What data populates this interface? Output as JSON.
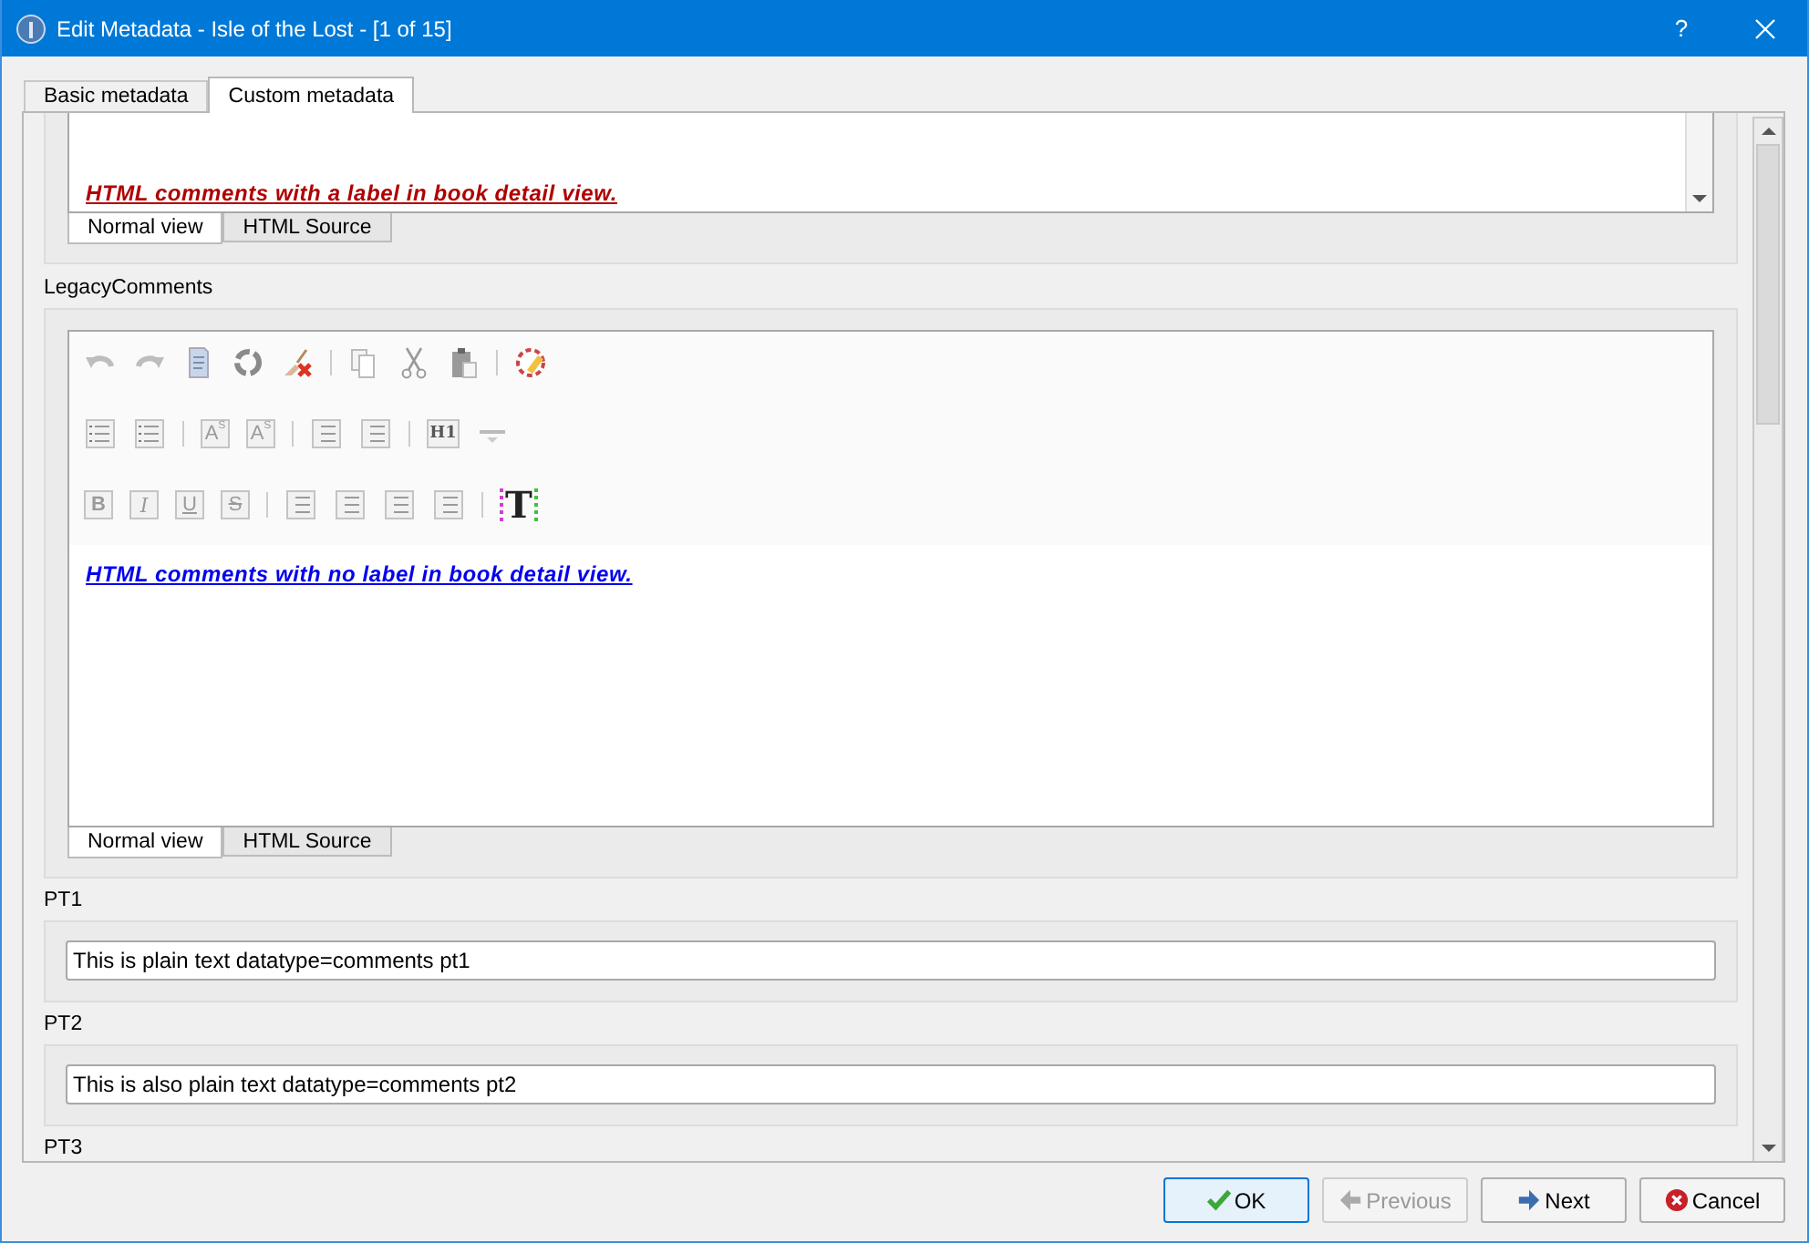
{
  "window": {
    "title": "Edit Metadata - Isle of the Lost -  [1 of 15]",
    "help": "?"
  },
  "tabs": [
    {
      "label": "Basic metadata",
      "selected": false
    },
    {
      "label": "Custom metadata",
      "selected": true
    }
  ],
  "editors": [
    {
      "show_toolbar": false,
      "content": "HTML comments with a label in book detail view.",
      "color": "#b00000",
      "view_tabs": [
        {
          "label": "Normal view",
          "selected": true
        },
        {
          "label": "HTML Source",
          "selected": false
        }
      ]
    },
    {
      "label": "LegacyComments",
      "show_toolbar": true,
      "content": "HTML comments with no label in book detail view.",
      "color": "#0000ee",
      "view_tabs": [
        {
          "label": "Normal view",
          "selected": true
        },
        {
          "label": "HTML Source",
          "selected": false
        }
      ]
    }
  ],
  "toolbar": [
    [
      {
        "kind": "undo"
      },
      {
        "kind": "redo"
      },
      {
        "kind": "document"
      },
      {
        "kind": "recycle"
      },
      {
        "kind": "clear"
      },
      {
        "kind": "separator"
      },
      {
        "kind": "copy"
      },
      {
        "kind": "cut"
      },
      {
        "kind": "paste"
      },
      {
        "kind": "separator"
      },
      {
        "kind": "palette"
      }
    ],
    [
      {
        "kind": "numbered"
      },
      {
        "kind": "bulleted"
      },
      {
        "kind": "separator"
      },
      {
        "kind": "superscript",
        "text": "A",
        "sub": "S"
      },
      {
        "kind": "subscript",
        "text": "A",
        "sub": "S"
      },
      {
        "kind": "separator"
      },
      {
        "kind": "indent"
      },
      {
        "kind": "outdent"
      },
      {
        "kind": "separator"
      },
      {
        "kind": "heading",
        "text": "H1"
      },
      {
        "kind": "rule"
      }
    ],
    [
      {
        "kind": "bold",
        "text": "B"
      },
      {
        "kind": "italic",
        "text": "I"
      },
      {
        "kind": "underline",
        "text": "U"
      },
      {
        "kind": "strike",
        "text": "S"
      },
      {
        "kind": "separator"
      },
      {
        "kind": "align"
      },
      {
        "kind": "align"
      },
      {
        "kind": "align"
      },
      {
        "kind": "align"
      },
      {
        "kind": "separator"
      },
      {
        "kind": "textcolor",
        "text": "T"
      }
    ]
  ],
  "fields": [
    {
      "label": "PT1",
      "value": "This is plain text datatype=comments pt1"
    },
    {
      "label": "PT2",
      "value": "This is also plain text datatype=comments pt2"
    },
    {
      "label": "PT3"
    }
  ],
  "buttons": [
    {
      "label": "OK",
      "kind": "ok",
      "disabled": false,
      "default": true
    },
    {
      "label": "Previous",
      "kind": "previous",
      "disabled": true,
      "default": false
    },
    {
      "label": "Next",
      "kind": "next",
      "disabled": false,
      "default": false
    },
    {
      "label": "Cancel",
      "kind": "cancel",
      "disabled": false,
      "default": false
    }
  ]
}
